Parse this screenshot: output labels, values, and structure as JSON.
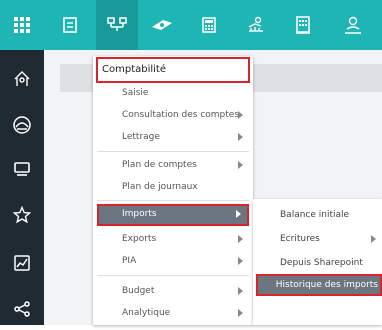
{
  "topbar": {
    "icons": [
      "grid-icon",
      "journal-icon",
      "hierarchy-icon",
      "money-icon",
      "calculator-icon",
      "bank-icon",
      "building-icon",
      "user-icon"
    ]
  },
  "leftbar": {
    "icons": [
      "home-icon",
      "dashboard-icon",
      "layers-icon",
      "star-icon",
      "chart-icon",
      "share-icon"
    ]
  },
  "menu": {
    "header": "Comptabilité",
    "items": [
      {
        "label": "Saisie"
      },
      {
        "label": "Consultation des comptes"
      },
      {
        "label": "Lettrage"
      },
      {
        "label": "Plan de comptes"
      },
      {
        "label": "Plan de journaux"
      },
      {
        "label": "Imports"
      },
      {
        "label": "Exports"
      },
      {
        "label": "PIA"
      },
      {
        "label": "Budget"
      },
      {
        "label": "Analytique"
      }
    ]
  },
  "submenu": {
    "items": [
      {
        "label": "Balance initiale"
      },
      {
        "label": "Ecritures"
      },
      {
        "label": "Depuis Sharepoint"
      },
      {
        "label": "Historique des imports"
      }
    ]
  },
  "colors": {
    "topbar": "#1fb5b5",
    "sidebar": "#1f2a33",
    "selected": "#6b7681",
    "highlight_border": "#d9242b"
  }
}
